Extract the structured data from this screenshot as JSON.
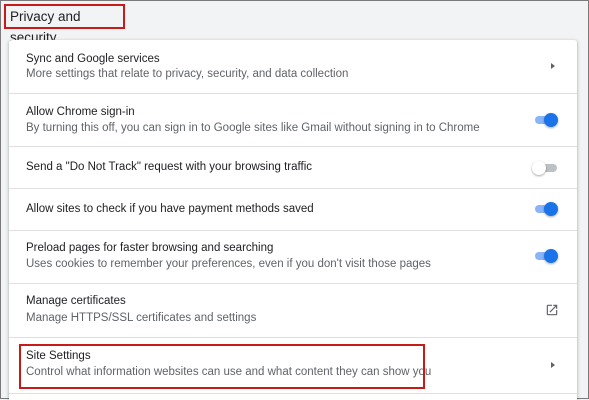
{
  "section": {
    "title": "Privacy and security"
  },
  "rows": [
    {
      "title": "Sync and Google services",
      "subtitle": "More settings that relate to privacy, security, and data collection",
      "control": "arrow"
    },
    {
      "title": "Allow Chrome sign-in",
      "subtitle": "By turning this off, you can sign in to Google sites like Gmail without signing in to Chrome",
      "control": "toggle",
      "state": "on"
    },
    {
      "title": "Send a \"Do Not Track\" request with your browsing traffic",
      "control": "toggle",
      "state": "off"
    },
    {
      "title": "Allow sites to check if you have payment methods saved",
      "control": "toggle",
      "state": "on"
    },
    {
      "title": "Preload pages for faster browsing and searching",
      "subtitle": "Uses cookies to remember your preferences, even if you don't visit those pages",
      "control": "toggle",
      "state": "on"
    },
    {
      "title": "Manage certificates",
      "subtitle": "Manage HTTPS/SSL certificates and settings",
      "control": "external-link"
    },
    {
      "title": "Site Settings",
      "subtitle": "Control what information websites can use and what content they can show you",
      "control": "arrow"
    }
  ],
  "colors": {
    "toggle_on": "#1a73e8",
    "toggle_on_track": "#8ab4f8",
    "highlight": "#c91a1a"
  }
}
